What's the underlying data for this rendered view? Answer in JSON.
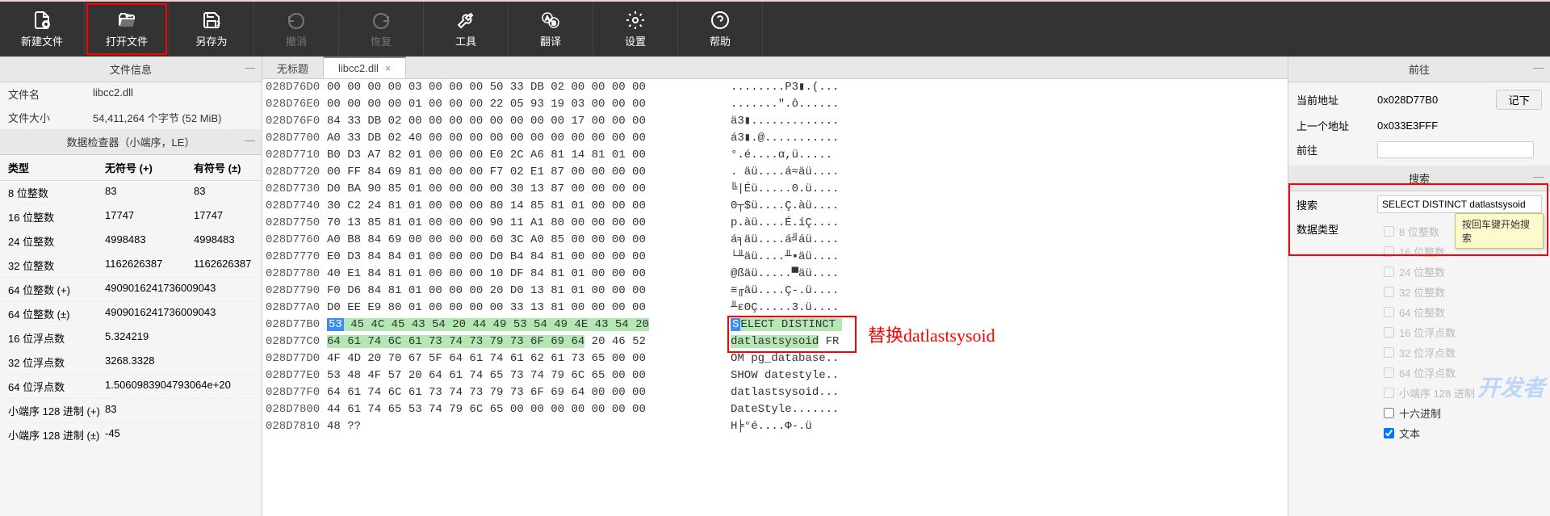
{
  "toolbar": [
    {
      "label": "新建文件",
      "icon": "file-plus"
    },
    {
      "label": "打开文件",
      "icon": "folder-open",
      "highlighted": true
    },
    {
      "label": "另存为",
      "icon": "save"
    },
    {
      "label": "撤消",
      "icon": "undo",
      "disabled": true
    },
    {
      "label": "恢复",
      "icon": "redo",
      "disabled": true
    },
    {
      "label": "工具",
      "icon": "wrench"
    },
    {
      "label": "翻译",
      "icon": "translate"
    },
    {
      "label": "设置",
      "icon": "gear"
    },
    {
      "label": "帮助",
      "icon": "help"
    }
  ],
  "file_info": {
    "panel_title": "文件信息",
    "name_label": "文件名",
    "name_value": "libcc2.dll",
    "size_label": "文件大小",
    "size_value": "54,411,264 个字节 (52 MiB)"
  },
  "inspector": {
    "panel_title": "数据检查器（小端序，LE）",
    "col_type": "类型",
    "col_unsigned": "无符号 (+)",
    "col_signed": "有符号 (±)",
    "rows": [
      {
        "type": "8 位整数",
        "u": "83",
        "s": "83"
      },
      {
        "type": "16 位整数",
        "u": "17747",
        "s": "17747"
      },
      {
        "type": "24 位整数",
        "u": "4998483",
        "s": "4998483"
      },
      {
        "type": "32 位整数",
        "u": "1162626387",
        "s": "1162626387"
      },
      {
        "type": "64 位整数 (+)",
        "u": "4909016241736009043",
        "s": ""
      },
      {
        "type": "64 位整数 (±)",
        "u": "4909016241736009043",
        "s": ""
      },
      {
        "type": "16 位浮点数",
        "u": "5.324219",
        "s": ""
      },
      {
        "type": "32 位浮点数",
        "u": "3268.3328",
        "s": ""
      },
      {
        "type": "64 位浮点数",
        "u": "1.5060983904793064e+20",
        "s": ""
      },
      {
        "type": "小端序 128 进制 (+)",
        "u": "83",
        "s": ""
      },
      {
        "type": "小端序 128 进制 (±)",
        "u": "-45",
        "s": ""
      }
    ]
  },
  "tabs": [
    {
      "label": "无标题",
      "active": false,
      "closeable": false
    },
    {
      "label": "libcc2.dll",
      "active": true,
      "closeable": true
    }
  ],
  "hex_rows": [
    {
      "o": "028D76D0",
      "b": "00 00 00 00 03 00 00 00 50 33 DB 02 00 00 00 00",
      "a": "........P3▮.(..."
    },
    {
      "o": "028D76E0",
      "b": "00 00 00 00 01 00 00 00 22 05 93 19 03 00 00 00",
      "a": ".......\".ô......"
    },
    {
      "o": "028D76F0",
      "b": "84 33 DB 02 00 00 00 00 00 00 00 00 17 00 00 00",
      "a": "ä3▮............."
    },
    {
      "o": "028D7700",
      "b": "A0 33 DB 02 40 00 00 00 00 00 00 00 00 00 00 00",
      "a": "á3▮.@..........."
    },
    {
      "o": "028D7710",
      "b": "B0 D3 A7 82 01 00 00 00 E0 2C A6 81 14 81 01 00",
      "a": "°.é....α,ü....."
    },
    {
      "o": "028D7720",
      "b": "00 FF 84 69 81 00 00 00 F7 02 E1 87 00 00 00 00",
      "a": ". äü....á≈äü...."
    },
    {
      "o": "028D7730",
      "b": "D0 BA 90 85 01 00 00 00 00 30 13 87 00 00 00 00",
      "a": "╚|Éü.....0.ü...."
    },
    {
      "o": "028D7740",
      "b": "30 C2 24 81 01 00 00 00 80 14 85 81 01 00 00 00",
      "a": "0┬$ü....Ç.àü...."
    },
    {
      "o": "028D7750",
      "b": "70 13 85 81 01 00 00 00 90 11 A1 80 00 00 00 00",
      "a": "p.àü....É.íÇ...."
    },
    {
      "o": "028D7760",
      "b": "A0 B8 84 69 00 00 00 00 60 3C A0 85 00 00 00 00",
      "a": "á╕äü....á╝áü...."
    },
    {
      "o": "028D7770",
      "b": "E0 D3 84 84 01 00 00 00 D0 B4 84 81 00 00 00 00",
      "a": "└╨äü....╨▪äü...."
    },
    {
      "o": "028D7780",
      "b": "40 E1 84 81 01 00 00 00 10 DF 84 81 01 00 00 00",
      "a": "@ßäü.....▀äü...."
    },
    {
      "o": "028D7790",
      "b": "F0 D6 84 81 01 00 00 00 20 D0 13 81 01 00 00 00",
      "a": "≡╓äü....Ç-.ü...."
    },
    {
      "o": "028D77A0",
      "b": "D0 EE E9 80 01 00 00 00 00 33 13 81 00 00 00 00",
      "a": "╨εΘÇ.....3.ü...."
    },
    {
      "o": "028D77B0",
      "b": "53 45 4C 45 43 54 20 44 49 53 54 49 4E 43 54 20",
      "a": "SELECT DISTINCT ",
      "hl": true,
      "first": true
    },
    {
      "o": "028D77C0",
      "b": "64 61 74 6C 61 73 74 73 79 73 6F 69 64 20 46 52",
      "a": "datlastsysoid FR",
      "hl": true
    },
    {
      "o": "028D77D0",
      "b": "4F 4D 20 70 67 5F 64 61 74 61 62 61 73 65 00 00",
      "a": "OM pg_database.."
    },
    {
      "o": "028D77E0",
      "b": "53 48 4F 57 20 64 61 74 65 73 74 79 6C 65 00 00",
      "a": "SHOW datestyle.."
    },
    {
      "o": "028D77F0",
      "b": "64 61 74 6C 61 73 74 73 79 73 6F 69 64 00 00 00",
      "a": "datlastsysoid..."
    },
    {
      "o": "028D7800",
      "b": "44 61 74 65 53 74 79 6C 65 00 00 00 00 00 00 00",
      "a": "DateStyle......."
    },
    {
      "o": "028D7810",
      "b": "48 ??                                            ",
      "a": "H╞°é....Φ-.ü"
    }
  ],
  "annotation_text": "替换datlastsysoid",
  "goto": {
    "panel_title": "前往",
    "cur_label": "当前地址",
    "cur_value": "0x028D77B0",
    "button_label": "记下",
    "prev_label": "上一个地址",
    "prev_value": "0x033E3FFF",
    "goto_label": "前往"
  },
  "search": {
    "panel_title": "搜索",
    "search_label": "搜索",
    "search_value": "SELECT DISTINCT datlastsysoid",
    "type_label": "数据类型",
    "tooltip": "按回车键开始搜索",
    "types": [
      {
        "label": "8 位整数",
        "checked": false,
        "disabled": true
      },
      {
        "label": "16 位整数",
        "checked": false,
        "disabled": true
      },
      {
        "label": "24 位整数",
        "checked": false,
        "disabled": true
      },
      {
        "label": "32 位整数",
        "checked": false,
        "disabled": true
      },
      {
        "label": "64 位整数",
        "checked": false,
        "disabled": true
      },
      {
        "label": "16 位浮点数",
        "checked": false,
        "disabled": true
      },
      {
        "label": "32 位浮点数",
        "checked": false,
        "disabled": true
      },
      {
        "label": "64 位浮点数",
        "checked": false,
        "disabled": true
      },
      {
        "label": "小端序 128 进制",
        "checked": false,
        "disabled": true
      },
      {
        "label": "十六进制",
        "checked": false,
        "disabled": false
      },
      {
        "label": "文本",
        "checked": true,
        "disabled": false
      }
    ]
  },
  "watermark": "开发者"
}
